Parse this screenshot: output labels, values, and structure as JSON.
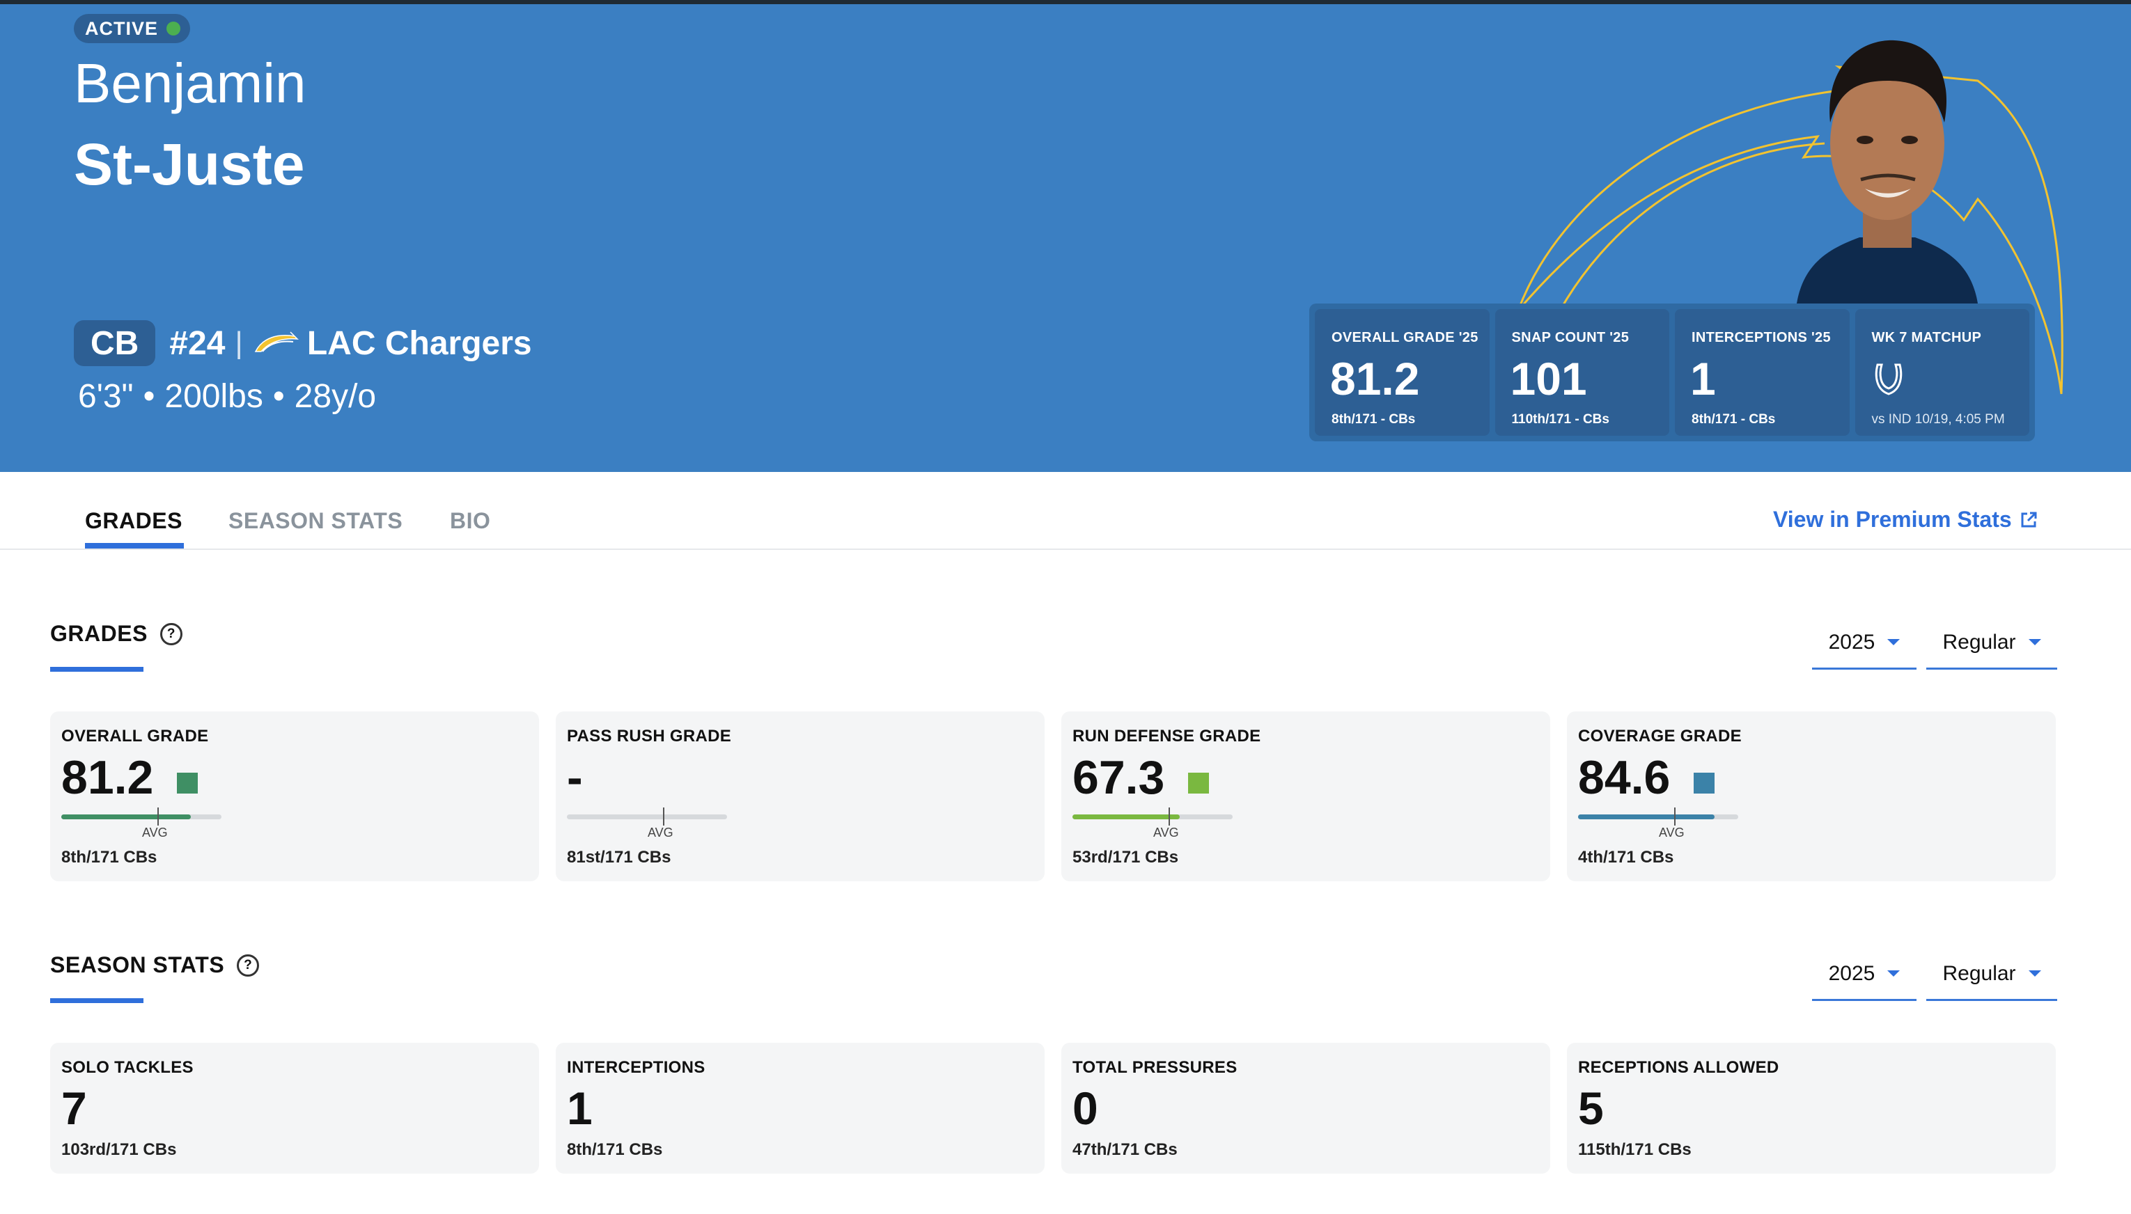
{
  "player": {
    "status": "ACTIVE",
    "first_name": "Benjamin",
    "last_name": "St-Juste",
    "position": "CB",
    "jersey": "#24",
    "separator": "|",
    "team": "LAC Chargers",
    "height": "6'3\"",
    "weight": "200lbs",
    "age": "28y/o",
    "meta_dot": "•"
  },
  "hero_stats": [
    {
      "label": "OVERALL GRADE '25",
      "value": "81.2",
      "rank": "8th/171 - CBs"
    },
    {
      "label": "SNAP COUNT '25",
      "value": "101",
      "rank": "110th/171 - CBs"
    },
    {
      "label": "INTERCEPTIONS '25",
      "value": "1",
      "rank": "8th/171 - CBs"
    },
    {
      "label": "WK 7 MATCHUP",
      "icon": "colts-horseshoe-icon",
      "sub": "vs IND 10/19, 4:05 PM"
    }
  ],
  "tabs": {
    "grades": "GRADES",
    "season_stats": "SEASON STATS",
    "bio": "BIO",
    "active": "GRADES"
  },
  "premium_link": "View in Premium Stats",
  "grades_section": {
    "title": "GRADES",
    "help": "?",
    "year": "2025",
    "season_type": "Regular",
    "avg_label": "AVG",
    "cards": [
      {
        "label": "OVERALL GRADE",
        "value": "81.2",
        "rank": "8th/171 CBs",
        "fill": 0.81,
        "color": "#3f8f64"
      },
      {
        "label": "PASS RUSH GRADE",
        "value": "-",
        "rank": "81st/171 CBs",
        "fill": 0,
        "color": "#c9ccd0"
      },
      {
        "label": "RUN DEFENSE GRADE",
        "value": "67.3",
        "rank": "53rd/171 CBs",
        "fill": 0.67,
        "color": "#7ab840"
      },
      {
        "label": "COVERAGE GRADE",
        "value": "84.6",
        "rank": "4th/171 CBs",
        "fill": 0.85,
        "color": "#3b82a8"
      }
    ]
  },
  "stats_section": {
    "title": "SEASON STATS",
    "help": "?",
    "year": "2025",
    "season_type": "Regular",
    "cards": [
      {
        "label": "SOLO TACKLES",
        "value": "7",
        "rank": "103rd/171 CBs"
      },
      {
        "label": "INTERCEPTIONS",
        "value": "1",
        "rank": "8th/171 CBs"
      },
      {
        "label": "TOTAL PRESSURES",
        "value": "0",
        "rank": "47th/171 CBs"
      },
      {
        "label": "RECEPTIONS ALLOWED",
        "value": "5",
        "rank": "115th/171 CBs"
      }
    ]
  },
  "colors": {
    "hero_bg": "#3b7fc2",
    "accent": "#2f6fdb",
    "bolt": "#f2c330"
  }
}
